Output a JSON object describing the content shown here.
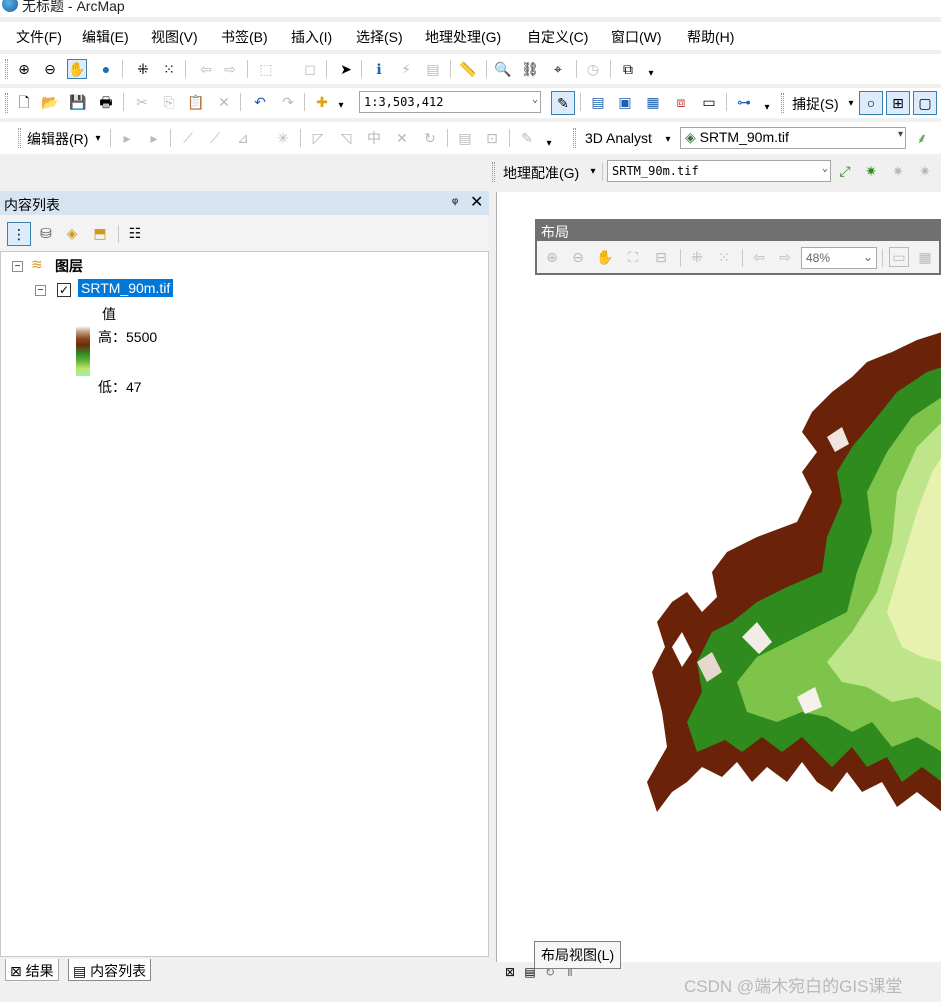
{
  "window": {
    "title": "无标题 - ArcMap"
  },
  "menu": [
    "文件(F)",
    "编辑(E)",
    "视图(V)",
    "书签(B)",
    "插入(I)",
    "选择(S)",
    "地理处理(G)",
    "自定义(C)",
    "窗口(W)",
    "帮助(H)"
  ],
  "toolbar": {
    "scale": "1:3,503,412",
    "snapping_label": "捕捉(S)",
    "editor_label": "编辑器(R)",
    "analyst_label": "3D Analyst",
    "analyst_layer": "SRTM_90m.tif",
    "georef_label": "地理配准(G)",
    "georef_layer": "SRTM_90m.tif"
  },
  "toc": {
    "title": "内容列表",
    "pin": "ᵠ",
    "close": "✕",
    "group_label": "图层",
    "layer_name": "SRTM_90m.tif",
    "legend_field": "值",
    "legend_high": "高：5500",
    "legend_low": "低：47"
  },
  "bottom_tabs": {
    "results": "结果",
    "toc": "内容列表"
  },
  "layout_toolbar": {
    "title": "布局",
    "zoom": "48%"
  },
  "tooltip": "布局视图(L)",
  "watermark": "CSDN @端木宛白的GIS课堂",
  "colors": {
    "toc_header": "#d7e4f2",
    "selection": "#0078d7",
    "elevation_ramp": [
      "#ffffff",
      "#8a4b1e",
      "#2f8b1d",
      "#bde46a",
      "#9bf3a9"
    ]
  }
}
